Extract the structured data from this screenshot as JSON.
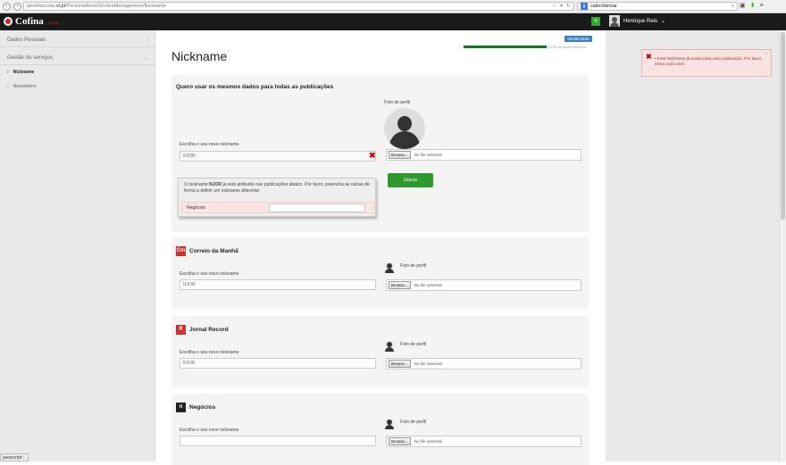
{
  "browser": {
    "url_prefix": "aminhaconta.",
    "url_domain": "xl.pt",
    "url_path": "/PersonalArea/ServiceManagement/Nickname",
    "search_value": "calendarizar",
    "status_text": "javascript:;"
  },
  "header": {
    "logo": "Cofina",
    "logo_sub": "MEDIA",
    "user_name": "Henrique Reis",
    "notif_count": "0"
  },
  "sidebar": {
    "items": [
      {
        "label": "Dados Pessoais"
      },
      {
        "label": "Gestão de serviços"
      }
    ],
    "sub_items": [
      {
        "label": "Nickname",
        "active": true
      },
      {
        "label": "Newsletters",
        "active": false
      }
    ]
  },
  "main": {
    "title": "Nickname",
    "beta_label": "Versão Beta",
    "progress_text": "100% do perfil completo",
    "progress": 1.0
  },
  "general": {
    "heading": "Quero usar os mesmos dados para todas as publicações",
    "photo_label": "Foto de perfil",
    "nick_label": "Escolha o seu novo nickname",
    "nick_value": "NJOR",
    "browse_label": "Browse...",
    "no_file": "No file selected.",
    "notice_pre": "O nickname ",
    "notice_nick": "NJOR",
    "notice_post": " já está atribuído nas publicações abaixo. Por favor, preencha as caixas de forma a definir um nickname diferente:",
    "conflict_pub": "Negócios",
    "save_label": "Gravar"
  },
  "publications": [
    {
      "name": "Correio da Manhã",
      "icon_text": "Cm",
      "icon_color": "#d32f2f",
      "nick_label": "Escolha o seu novo nickname",
      "nick_value": "NJOR",
      "photo_label": "Foto de perfil",
      "browse_label": "Browse...",
      "no_file": "No file selected."
    },
    {
      "name": "Jornal Record",
      "icon_text": "R",
      "icon_color": "#d32f2f",
      "nick_label": "Escolha o seu novo nickname",
      "nick_value": "NJOR",
      "photo_label": "Foto de perfil",
      "browse_label": "Browse...",
      "no_file": "No file selected."
    },
    {
      "name": "Negócios",
      "icon_text": "n",
      "icon_color": "#222222",
      "nick_label": "Escolha o seu novo nickname",
      "nick_value": "",
      "photo_label": "Foto de perfil",
      "browse_label": "Browse...",
      "no_file": "No file selected."
    }
  ],
  "alert": {
    "message": "• Este Nickname já existe para esta publicação. Por favor, insira outro nick.",
    "close": "×"
  }
}
